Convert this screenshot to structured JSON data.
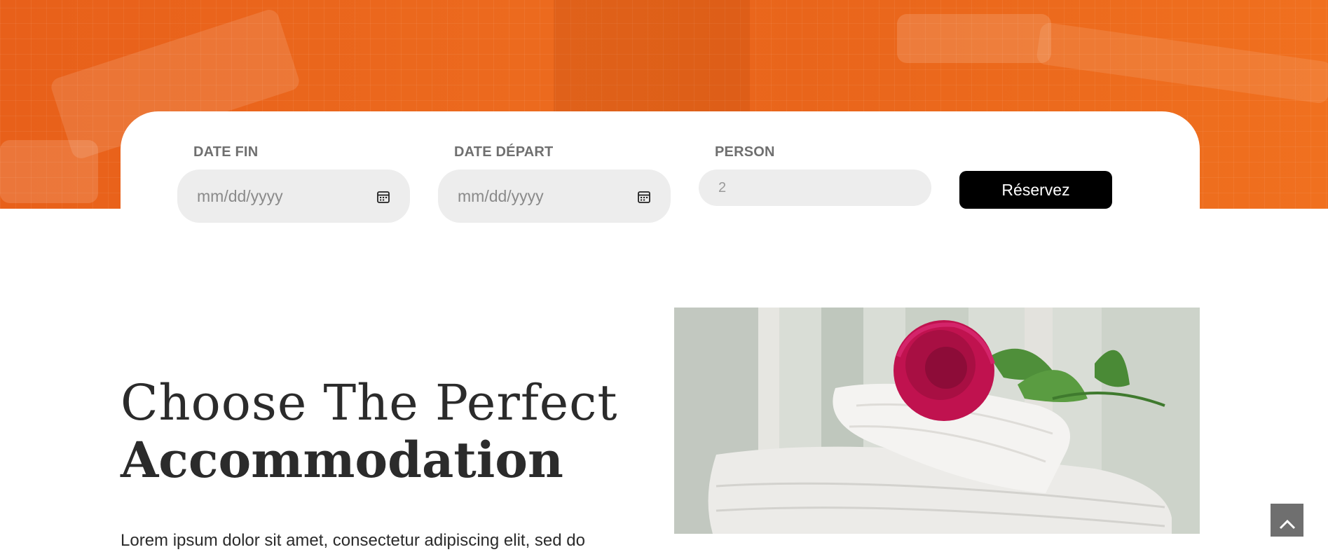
{
  "booking": {
    "date_fin_label": "DATE FIN",
    "date_fin_placeholder": "mm/dd/yyyy",
    "date_depart_label": "DATE DÉPART",
    "date_depart_placeholder": "mm/dd/yyyy",
    "person_label": "PERSON",
    "person_value": "2",
    "reserve_label": "Réservez"
  },
  "section": {
    "title_line1": "Choose The Perfect",
    "title_line2": "Accommodation",
    "body_text": "Lorem ipsum dolor sit amet, consectetur adipiscing elit, sed do"
  },
  "icons": {
    "calendar": "calendar-icon",
    "scroll_top": "chevron-up-icon"
  },
  "colors": {
    "hero_orange": "#e9631c",
    "button_black": "#000000",
    "input_bg": "#ededed",
    "scroll_top_bg": "#6f6f6f"
  }
}
